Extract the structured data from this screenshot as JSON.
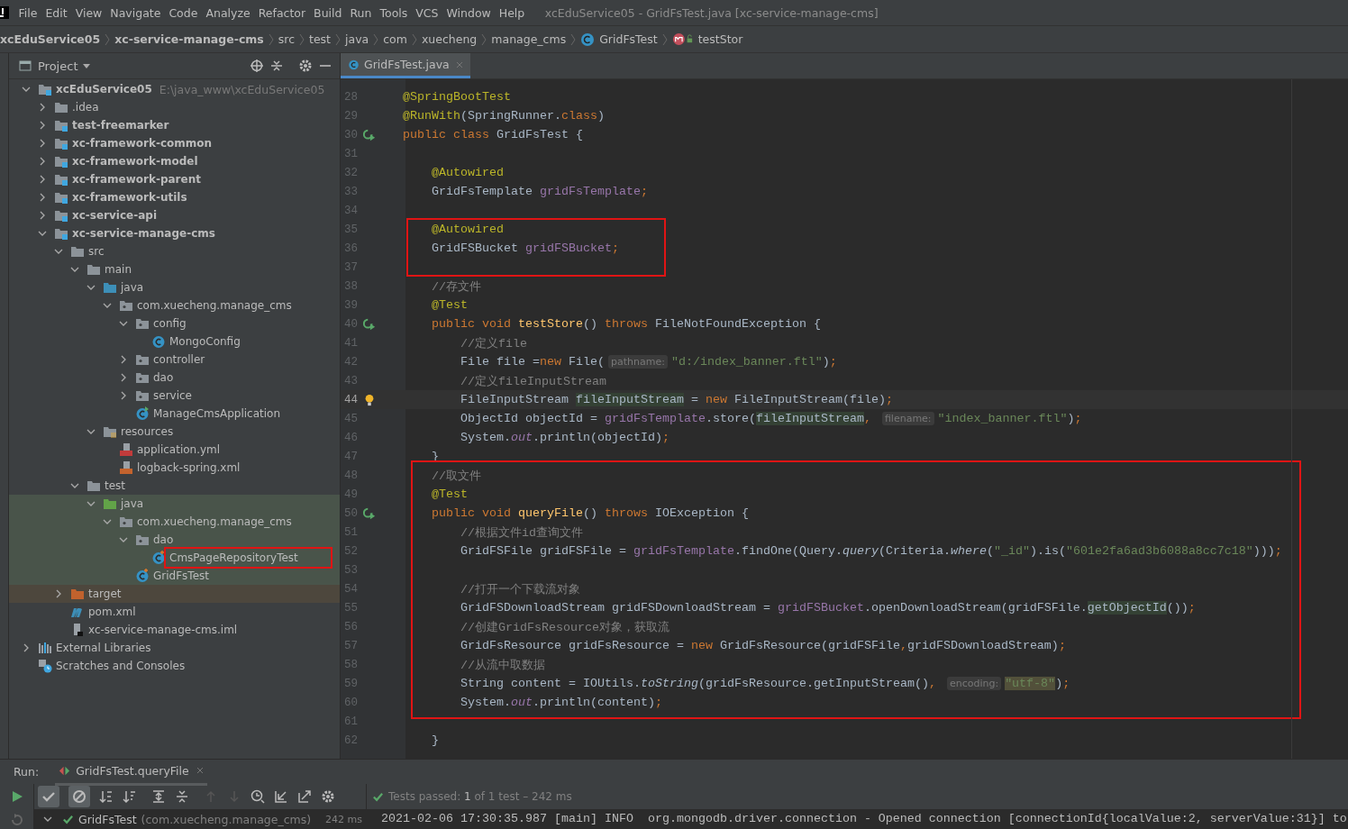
{
  "menu": [
    "File",
    "Edit",
    "View",
    "Navigate",
    "Code",
    "Analyze",
    "Refactor",
    "Build",
    "Run",
    "Tools",
    "VCS",
    "Window",
    "Help"
  ],
  "window": {
    "title": "xcEduService05 - GridFsTest.java [xc-service-manage-cms]"
  },
  "breadcrumbs": [
    {
      "text": "xcEduService05",
      "kind": "module"
    },
    {
      "text": "xc-service-manage-cms",
      "kind": "module"
    },
    {
      "text": "src",
      "kind": "dir"
    },
    {
      "text": "test",
      "kind": "dir"
    },
    {
      "text": "java",
      "kind": "dir"
    },
    {
      "text": "com",
      "kind": "dir"
    },
    {
      "text": "xuecheng",
      "kind": "dir"
    },
    {
      "text": "manage_cms",
      "kind": "dir"
    },
    {
      "text": "GridFsTest",
      "kind": "class"
    },
    {
      "text": "testStor",
      "kind": "method"
    }
  ],
  "project": {
    "title": "Project",
    "tree": [
      {
        "name": "xcEduService05",
        "kind": "module",
        "path": "E:\\java_www\\xcEduService05",
        "expanded": true,
        "children": [
          {
            "name": ".idea",
            "kind": "folder",
            "expanded": false
          },
          {
            "name": "test-freemarker",
            "kind": "module",
            "expanded": false
          },
          {
            "name": "xc-framework-common",
            "kind": "module",
            "expanded": false
          },
          {
            "name": "xc-framework-model",
            "kind": "module",
            "expanded": false
          },
          {
            "name": "xc-framework-parent",
            "kind": "module",
            "expanded": false
          },
          {
            "name": "xc-framework-utils",
            "kind": "module",
            "expanded": false
          },
          {
            "name": "xc-service-api",
            "kind": "module",
            "expanded": false
          },
          {
            "name": "xc-service-manage-cms",
            "kind": "module",
            "expanded": true,
            "children": [
              {
                "name": "src",
                "kind": "folder",
                "expanded": true,
                "children": [
                  {
                    "name": "main",
                    "kind": "folder",
                    "expanded": true,
                    "children": [
                      {
                        "name": "java",
                        "kind": "source-folder",
                        "expanded": true,
                        "children": [
                          {
                            "name": "com.xuecheng.manage_cms",
                            "kind": "package",
                            "expanded": true,
                            "children": [
                              {
                                "name": "config",
                                "kind": "package",
                                "expanded": true,
                                "children": [
                                  {
                                    "name": "MongoConfig",
                                    "kind": "class"
                                  }
                                ]
                              },
                              {
                                "name": "controller",
                                "kind": "package",
                                "expanded": false
                              },
                              {
                                "name": "dao",
                                "kind": "package",
                                "expanded": false
                              },
                              {
                                "name": "service",
                                "kind": "package",
                                "expanded": false
                              },
                              {
                                "name": "ManageCmsApplication",
                                "kind": "app-class"
                              }
                            ]
                          }
                        ]
                      },
                      {
                        "name": "resources",
                        "kind": "resources-folder",
                        "expanded": true,
                        "children": [
                          {
                            "name": "application.yml",
                            "kind": "yml"
                          },
                          {
                            "name": "logback-spring.xml",
                            "kind": "xml"
                          }
                        ]
                      }
                    ]
                  },
                  {
                    "name": "test",
                    "kind": "folder",
                    "expanded": true,
                    "children": [
                      {
                        "name": "java",
                        "kind": "test-folder",
                        "test_source": true,
                        "expanded": true,
                        "children": [
                          {
                            "name": "com.xuecheng.manage_cms",
                            "kind": "package",
                            "expanded": true,
                            "children": [
                              {
                                "name": "dao",
                                "kind": "package",
                                "expanded": true,
                                "children": [
                                  {
                                    "name": "CmsPageRepositoryTest",
                                    "kind": "test-class",
                                    "boxed": true
                                  }
                                ]
                              },
                              {
                                "name": "GridFsTest",
                                "kind": "test-class"
                              }
                            ]
                          }
                        ]
                      }
                    ]
                  }
                ]
              },
              {
                "name": "target",
                "kind": "excluded-folder",
                "excluded": true,
                "expanded": false
              },
              {
                "name": "pom.xml",
                "kind": "maven"
              },
              {
                "name": "xc-service-manage-cms.iml",
                "kind": "iml"
              }
            ]
          }
        ]
      },
      {
        "name": "External Libraries",
        "kind": "libraries",
        "expanded": false
      },
      {
        "name": "Scratches and Consoles",
        "kind": "scratches"
      }
    ]
  },
  "editor": {
    "tabs": [
      {
        "label": "GridFsTest.java",
        "selected": true
      }
    ],
    "sections": [
      {
        "boxed": false,
        "lines": [
          {
            "no": "28",
            "tokens": [
              {
                "kind": "ann",
                "text": "@SpringBootTest"
              }
            ]
          },
          {
            "no": "29",
            "tokens": [
              {
                "kind": "ann",
                "text": "@RunWith"
              },
              {
                "kind": "plain",
                "text": "(SpringRunner."
              },
              {
                "kind": "kw",
                "text": "class"
              },
              {
                "kind": "plain",
                "text": ")"
              }
            ]
          },
          {
            "no": "30",
            "run_icon": true,
            "tokens": [
              {
                "kind": "kw",
                "text": "public class "
              },
              {
                "kind": "plain",
                "text": "GridFsTest {"
              }
            ]
          },
          {
            "no": "31"
          },
          {
            "no": "32",
            "tokens": [
              {
                "kind": "ann",
                "text": "    @Autowired"
              }
            ]
          },
          {
            "no": "33",
            "tokens": [
              {
                "kind": "plain",
                "text": "    GridFsTemplate "
              },
              {
                "kind": "field",
                "text": "gridFsTemplate"
              },
              {
                "kind": "kw",
                "text": ";"
              }
            ]
          },
          {
            "no": "34"
          }
        ]
      },
      {
        "boxed": true,
        "lines": [
          {
            "no": "35",
            "tokens": [
              {
                "kind": "ann",
                "text": "    @Autowired"
              }
            ]
          },
          {
            "no": "36",
            "tokens": [
              {
                "kind": "plain",
                "text": "    GridFSBucket "
              },
              {
                "kind": "field",
                "text": "gridFSBucket"
              },
              {
                "kind": "kw",
                "text": ";"
              }
            ]
          },
          {
            "no": "37"
          }
        ]
      },
      {
        "boxed": false,
        "lines": [
          {
            "no": "38",
            "tokens": [
              {
                "kind": "comment",
                "text": "    //存文件"
              }
            ]
          },
          {
            "no": "39",
            "tokens": [
              {
                "kind": "ann",
                "text": "    @Test"
              }
            ]
          },
          {
            "no": "40",
            "run_icon": true,
            "tokens": [
              {
                "kind": "kw",
                "text": "    public void "
              },
              {
                "kind": "method",
                "text": "testStore"
              },
              {
                "kind": "plain",
                "text": "() "
              },
              {
                "kind": "kw",
                "text": "throws "
              },
              {
                "kind": "plain",
                "text": "FileNotFoundException {"
              }
            ]
          },
          {
            "no": "41",
            "tokens": [
              {
                "kind": "comment",
                "text": "        //定义file"
              }
            ]
          },
          {
            "no": "42",
            "tokens": [
              {
                "kind": "plain",
                "text": "        File file ="
              },
              {
                "kind": "kw",
                "text": "new "
              },
              {
                "kind": "plain",
                "text": "File("
              },
              {
                "kind": "hint",
                "text": "pathname:"
              },
              {
                "kind": "str",
                "text": "\"d:/index_banner.ftl\""
              },
              {
                "kind": "plain",
                "text": ")"
              },
              {
                "kind": "kw",
                "text": ";"
              }
            ]
          },
          {
            "no": "43",
            "tokens": [
              {
                "kind": "comment",
                "text": "        //定义fileInputStream"
              }
            ]
          },
          {
            "no": "44",
            "bulb": true,
            "current": true,
            "tokens": [
              {
                "kind": "plain",
                "text": "        FileInputStream "
              },
              {
                "kind": "mark",
                "text": "fileInputStream"
              },
              {
                "kind": "plain",
                "text": " = "
              },
              {
                "kind": "kw",
                "text": "new "
              },
              {
                "kind": "plain",
                "text": "FileInputStream(file)"
              },
              {
                "kind": "kw",
                "text": ";"
              }
            ]
          },
          {
            "no": "45",
            "tokens": [
              {
                "kind": "plain",
                "text": "        ObjectId objectId = "
              },
              {
                "kind": "field",
                "text": "gridFsTemplate"
              },
              {
                "kind": "plain",
                "text": ".store("
              },
              {
                "kind": "mark",
                "text": "fileInputStream"
              },
              {
                "kind": "kw",
                "text": ", "
              },
              {
                "kind": "hint",
                "text": "filename:"
              },
              {
                "kind": "str",
                "text": "\"index_banner.ftl\""
              },
              {
                "kind": "plain",
                "text": ")"
              },
              {
                "kind": "kw",
                "text": ";"
              }
            ]
          },
          {
            "no": "46",
            "tokens": [
              {
                "kind": "plain",
                "text": "        System."
              },
              {
                "kind": "field-italic",
                "text": "out"
              },
              {
                "kind": "plain",
                "text": ".println(objectId)"
              },
              {
                "kind": "kw",
                "text": ";"
              }
            ]
          },
          {
            "no": "47",
            "tokens": [
              {
                "kind": "plain",
                "text": "    }"
              }
            ]
          }
        ]
      },
      {
        "boxed": true,
        "lines": [
          {
            "no": "48",
            "tokens": [
              {
                "kind": "comment",
                "text": "    //取文件"
              }
            ]
          },
          {
            "no": "49",
            "tokens": [
              {
                "kind": "ann",
                "text": "    @Test"
              }
            ]
          },
          {
            "no": "50",
            "run_icon": true,
            "tokens": [
              {
                "kind": "kw",
                "text": "    public void "
              },
              {
                "kind": "method",
                "text": "queryFile"
              },
              {
                "kind": "plain",
                "text": "() "
              },
              {
                "kind": "kw",
                "text": "throws "
              },
              {
                "kind": "plain",
                "text": "IOException {"
              }
            ]
          },
          {
            "no": "51",
            "tokens": [
              {
                "kind": "comment",
                "text": "        //根据文件id查询文件"
              }
            ]
          },
          {
            "no": "52",
            "tokens": [
              {
                "kind": "plain",
                "text": "        GridFSFile gridFSFile = "
              },
              {
                "kind": "field",
                "text": "gridFsTemplate"
              },
              {
                "kind": "plain",
                "text": ".findOne(Query."
              },
              {
                "kind": "italic",
                "text": "query"
              },
              {
                "kind": "plain",
                "text": "(Criteria."
              },
              {
                "kind": "italic",
                "text": "where"
              },
              {
                "kind": "plain",
                "text": "("
              },
              {
                "kind": "str",
                "text": "\"_id\""
              },
              {
                "kind": "plain",
                "text": ").is("
              },
              {
                "kind": "str",
                "text": "\"601e2fa6ad3b6088a8cc7c18\""
              },
              {
                "kind": "plain",
                "text": ")))"
              },
              {
                "kind": "kw",
                "text": ";"
              }
            ]
          },
          {
            "no": "53"
          },
          {
            "no": "54",
            "tokens": [
              {
                "kind": "comment",
                "text": "        //打开一个下载流对象"
              }
            ]
          },
          {
            "no": "55",
            "tokens": [
              {
                "kind": "plain",
                "text": "        GridFSDownloadStream gridFSDownloadStream = "
              },
              {
                "kind": "field",
                "text": "gridFSBucket"
              },
              {
                "kind": "plain",
                "text": ".openDownloadStream(gridFSFile."
              },
              {
                "kind": "mark",
                "text": "getObjectId"
              },
              {
                "kind": "plain",
                "text": "())"
              },
              {
                "kind": "kw",
                "text": ";"
              }
            ]
          },
          {
            "no": "56",
            "tokens": [
              {
                "kind": "comment",
                "text": "        //创建GridFsResource对象，获取流"
              }
            ]
          },
          {
            "no": "57",
            "tokens": [
              {
                "kind": "plain",
                "text": "        GridFsResource gridFsResource = "
              },
              {
                "kind": "kw",
                "text": "new "
              },
              {
                "kind": "plain",
                "text": "GridFsResource(gridFSFile"
              },
              {
                "kind": "kw",
                "text": ","
              },
              {
                "kind": "plain",
                "text": "gridFSDownloadStream)"
              },
              {
                "kind": "kw",
                "text": ";"
              }
            ]
          },
          {
            "no": "58",
            "tokens": [
              {
                "kind": "comment",
                "text": "        //从流中取数据"
              }
            ]
          },
          {
            "no": "59",
            "tokens": [
              {
                "kind": "plain",
                "text": "        String content = IOUtils."
              },
              {
                "kind": "italic",
                "text": "toString"
              },
              {
                "kind": "plain",
                "text": "(gridFsResource.getInputStream()"
              },
              {
                "kind": "kw",
                "text": ", "
              },
              {
                "kind": "hint",
                "text": "encoding:"
              },
              {
                "kind": "mark-str",
                "text": "\"utf-8\""
              },
              {
                "kind": "plain",
                "text": ")"
              },
              {
                "kind": "kw",
                "text": ";"
              }
            ]
          },
          {
            "no": "60",
            "tokens": [
              {
                "kind": "plain",
                "text": "        System."
              },
              {
                "kind": "field-italic",
                "text": "out"
              },
              {
                "kind": "plain",
                "text": ".println(content)"
              },
              {
                "kind": "kw",
                "text": ";"
              }
            ]
          }
        ]
      },
      {
        "boxed": false,
        "lines": [
          {
            "no": "61"
          },
          {
            "no": "62",
            "tokens": [
              {
                "kind": "plain",
                "text": "    }"
              }
            ]
          }
        ]
      }
    ]
  },
  "run": {
    "label": "Run:",
    "tabs": [
      {
        "label": "GridFsTest.queryFile",
        "selected": true
      }
    ],
    "toggles": [
      {
        "kind": "show-passed",
        "on": true
      },
      {
        "kind": "show-ignored",
        "on": true
      }
    ],
    "results": [
      {
        "name": "GridFsTest",
        "detail": "(com.xuecheng.manage_cms)",
        "time": "242 ms",
        "passed": true,
        "expanded": true
      }
    ],
    "status": "Tests passed: **1** of 1 test – 242 ms",
    "status_passed": true,
    "console": "2021-02-06 17:30:35.987 [main] INFO  org.mongodb.driver.connection - Opened connection [connectionId{localValue:2, serverValue:31}] to"
  }
}
